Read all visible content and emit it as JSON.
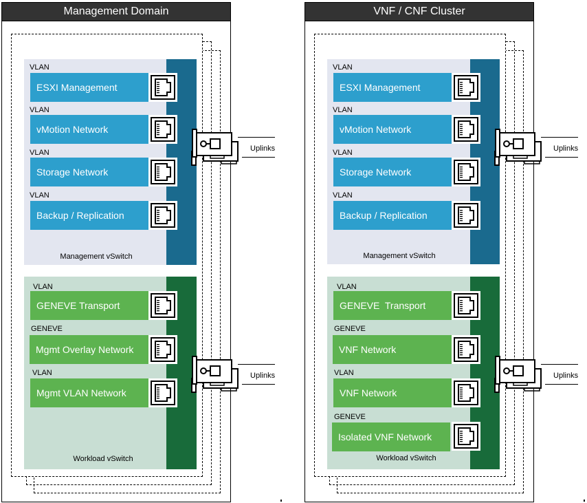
{
  "clusters": [
    {
      "title": "Management Domain",
      "management_switch": {
        "label": "Management vSwitch",
        "portgroups": [
          {
            "type": "VLAN",
            "name": "ESXI Management"
          },
          {
            "type": "VLAN",
            "name": "vMotion Network"
          },
          {
            "type": "VLAN",
            "name": "Storage Network"
          },
          {
            "type": "VLAN",
            "name": "Backup / Replication"
          }
        ]
      },
      "workload_switch": {
        "label": "Workload vSwitch",
        "portgroups": [
          {
            "type": "VLAN",
            "name": "GENEVE Transport"
          },
          {
            "type": "GENEVE",
            "name": "Mgmt Overlay Network"
          },
          {
            "type": "VLAN",
            "name": "Mgmt VLAN Network"
          }
        ]
      },
      "uplinks_label": "Uplinks"
    },
    {
      "title": "VNF / CNF Cluster",
      "management_switch": {
        "label": "Management vSwitch",
        "portgroups": [
          {
            "type": "VLAN",
            "name": "ESXI Management"
          },
          {
            "type": "VLAN",
            "name": "vMotion Network"
          },
          {
            "type": "VLAN",
            "name": "Storage Network"
          },
          {
            "type": "VLAN",
            "name": "Backup / Replication"
          }
        ]
      },
      "workload_switch": {
        "label": "Workload vSwitch",
        "portgroups": [
          {
            "type": "VLAN",
            "name": "GENEVE  Transport"
          },
          {
            "type": "GENEVE",
            "name": "VNF Network"
          },
          {
            "type": "VLAN",
            "name": "VNF Network"
          },
          {
            "type": "GENEVE",
            "name": "Isolated VNF Network"
          }
        ]
      },
      "uplinks_label": "Uplinks"
    }
  ],
  "colors": {
    "title_bar": "#333333",
    "mgmt_switch_bg": "#e3e6f0",
    "mgmt_uplink_bar": "#1a6a8e",
    "mgmt_portgroup": "#2d9fcd",
    "workload_switch_bg": "#c8ded3",
    "workload_uplink_bar": "#186b3a",
    "workload_portgroup": "#5db350"
  }
}
